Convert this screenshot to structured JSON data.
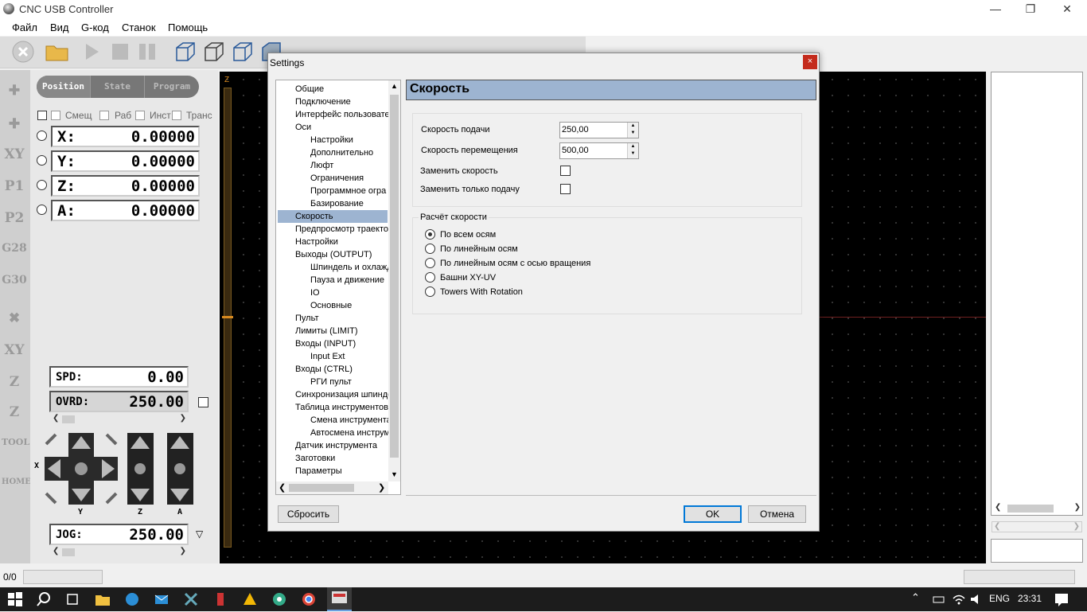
{
  "window": {
    "title": "CNC USB Controller"
  },
  "menu": [
    "Файл",
    "Вид",
    "G-код",
    "Станок",
    "Помощь"
  ],
  "view_tabs": [
    "Position",
    "State",
    "Program"
  ],
  "offset_checks": [
    "Смещ",
    "Раб",
    "Инст",
    "Транс"
  ],
  "axes": [
    {
      "label": "X:",
      "value": "0.00000"
    },
    {
      "label": "Y:",
      "value": "0.00000"
    },
    {
      "label": "Z:",
      "value": "0.00000"
    },
    {
      "label": "A:",
      "value": "0.00000"
    }
  ],
  "left_icons": [
    "XY",
    "P1",
    "P2",
    "G28",
    "G30",
    "XY",
    "Z",
    "Z",
    "TOOL",
    "HOME"
  ],
  "spd": {
    "label": "SPD:",
    "value": "0.00"
  },
  "ovrd": {
    "label": "OVRD:",
    "value": "250.00"
  },
  "jog": {
    "label": "JOG:",
    "value": "250.00"
  },
  "jog_axes": {
    "x": "X",
    "y": "Y",
    "z": "Z",
    "a": "A"
  },
  "canvas": {
    "z_label": "Z"
  },
  "status": {
    "count": "0/0"
  },
  "taskbar": {
    "lang": "ENG",
    "time": "23:31"
  },
  "dialog": {
    "title": "Settings",
    "close": "×",
    "tree": [
      {
        "label": "Общие",
        "level": 0
      },
      {
        "label": "Подключение",
        "level": 0
      },
      {
        "label": "Интерфейс пользовате",
        "level": 0
      },
      {
        "label": "Оси",
        "level": 0
      },
      {
        "label": "Настройки",
        "level": 1
      },
      {
        "label": "Дополнительно",
        "level": 1
      },
      {
        "label": "Люфт",
        "level": 1
      },
      {
        "label": "Ограничения",
        "level": 1
      },
      {
        "label": "Программное огра",
        "level": 1
      },
      {
        "label": "Базирование",
        "level": 1
      },
      {
        "label": "Скорость",
        "level": 0,
        "selected": true
      },
      {
        "label": "Предпросмотр траекто",
        "level": 0
      },
      {
        "label": "Настройки",
        "level": 0
      },
      {
        "label": "Выходы (OUTPUT)",
        "level": 0
      },
      {
        "label": "Шпиндель и охлажд",
        "level": 1
      },
      {
        "label": "Пауза и движение",
        "level": 1
      },
      {
        "label": "IO",
        "level": 1
      },
      {
        "label": "Основные",
        "level": 1
      },
      {
        "label": "Пульт",
        "level": 0
      },
      {
        "label": "Лимиты (LIMIT)",
        "level": 0
      },
      {
        "label": "Входы (INPUT)",
        "level": 0
      },
      {
        "label": "Input Ext",
        "level": 1
      },
      {
        "label": "Входы (CTRL)",
        "level": 0
      },
      {
        "label": "РГИ пульт",
        "level": 1
      },
      {
        "label": "Синхронизация шпинде",
        "level": 0
      },
      {
        "label": "Таблица инструментов",
        "level": 0
      },
      {
        "label": "Смена инструмента",
        "level": 1
      },
      {
        "label": "Автосмена инструм",
        "level": 1
      },
      {
        "label": "Датчик инструмента",
        "level": 0
      },
      {
        "label": "Заготовки",
        "level": 0
      },
      {
        "label": "Параметры",
        "level": 0
      }
    ],
    "section_title": "Скорость",
    "feed_label": "Скорость подачи",
    "feed_value": "250,00",
    "rapid_label": "Скорость перемещения",
    "rapid_value": "500,00",
    "override_label": "Заменить скорость",
    "override_feed_only_label": "Заменить только подачу",
    "calc_group_title": "Расчёт скорости",
    "calc_options": [
      {
        "label": "По всем осям",
        "selected": true
      },
      {
        "label": "По линейным осям",
        "selected": false
      },
      {
        "label": "По линейным осям с осью вращения",
        "selected": false
      },
      {
        "label": "Башни XY-UV",
        "selected": false
      },
      {
        "label": "Towers With Rotation",
        "selected": false
      }
    ],
    "reset_button": "Сбросить",
    "ok_button": "OK",
    "cancel_button": "Отмена"
  }
}
